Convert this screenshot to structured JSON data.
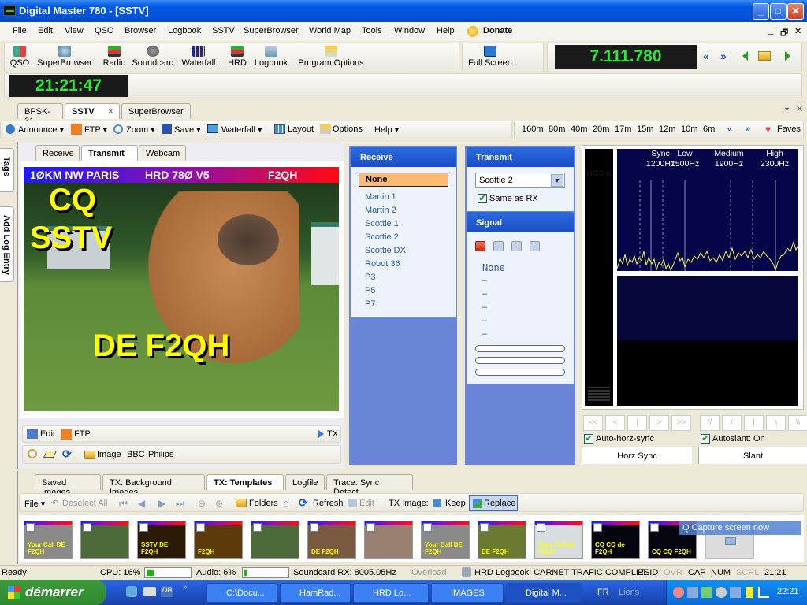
{
  "window": {
    "title": "Digital Master 780 - [SSTV]",
    "minimize": "_",
    "maximize": "□",
    "close": "✕"
  },
  "menu": {
    "items": [
      "File",
      "Edit",
      "View",
      "QSO",
      "Browser",
      "Logbook",
      "SSTV",
      "SuperBrowser",
      "World Map",
      "Tools",
      "Window",
      "Help"
    ],
    "donate": "Donate",
    "mdi_controls": [
      "_",
      "🗗",
      "✕"
    ]
  },
  "toolbar": {
    "buttons": [
      {
        "label": "QSO",
        "icon": "qso-icon"
      },
      {
        "label": "SuperBrowser",
        "icon": "superbrowser-icon"
      },
      {
        "label": "Radio",
        "icon": "radio-icon"
      },
      {
        "label": "Soundcard",
        "icon": "soundcard-icon"
      },
      {
        "label": "Waterfall",
        "icon": "waterfall-icon"
      },
      {
        "label": "HRD",
        "icon": "hrd-icon"
      },
      {
        "label": "Logbook",
        "icon": "logbook-icon"
      },
      {
        "label": "Program Options",
        "icon": "program-options-icon"
      }
    ],
    "full_screen": "Full Screen",
    "frequency": "7.111.780",
    "freq_prev": "«",
    "freq_next": "»",
    "clock": "21:21:47"
  },
  "doc_tabs": [
    {
      "label": "BPSK-31",
      "active": false
    },
    {
      "label": "SSTV",
      "active": true
    },
    {
      "label": "SuperBrowser",
      "active": false
    }
  ],
  "sstv_toolbar": {
    "items": [
      "Announce ▾",
      "FTP ▾",
      "Zoom ▾",
      "Save ▾",
      "Waterfall ▾",
      "Layout",
      "Options",
      "Help ▾"
    ],
    "bands": [
      "160m",
      "80m",
      "40m",
      "20m",
      "17m",
      "15m",
      "12m",
      "10m",
      "6m"
    ],
    "band_prev": "«",
    "band_next": "»",
    "faves": "Faves"
  },
  "side_tabs": [
    "Tags",
    "Add Log Entry"
  ],
  "image_tabs": [
    {
      "label": "Receive",
      "active": false
    },
    {
      "label": "Transmit",
      "active": true
    },
    {
      "label": "Webcam",
      "active": false
    }
  ],
  "tx_image": {
    "header_left": "1ØKM NW PARIS",
    "header_mid": "HRD 78Ø V5",
    "header_right": "F2QH",
    "text_cq": "CQ",
    "text_sstv": "SSTV",
    "text_de": "DE F2QH"
  },
  "image_toolbar1": {
    "edit": "Edit",
    "ftp": "FTP",
    "tx": "TX"
  },
  "image_toolbar2": {
    "image": "Image",
    "bbc": "BBC",
    "philips": "Philips"
  },
  "receive_panel": {
    "title": "Receive",
    "selected": "None",
    "modes": [
      "Martin 1",
      "Martin 2",
      "Scottie 1",
      "Scottie 2",
      "Scottie DX",
      "Robot 36",
      "P3",
      "P5",
      "P7"
    ]
  },
  "transmit_panel": {
    "title": "Transmit",
    "mode_value": "Scottie 2",
    "same_as_rx_label": "Same as RX",
    "same_as_rx_checked": true
  },
  "signal_panel": {
    "title": "Signal",
    "value": "None",
    "dashes": [
      "–",
      "–",
      "–",
      "–",
      "–"
    ]
  },
  "spectrum": {
    "labels": [
      {
        "name": "Sync",
        "freq": "1200Hz"
      },
      {
        "name": "Low",
        "freq": "1500Hz"
      },
      {
        "name": "Medium",
        "freq": "1900Hz"
      },
      {
        "name": "High",
        "freq": "2300Hz"
      }
    ]
  },
  "sync_controls": {
    "horz_buttons": [
      "<<",
      "<",
      "|",
      ">",
      ">>"
    ],
    "slant_buttons": [
      "//",
      "/",
      "|",
      "\\",
      "\\\\"
    ],
    "auto_horz_sync": "Auto-horz-sync",
    "auto_horz_checked": true,
    "autoslant": "Autoslant: On",
    "autoslant_checked": true,
    "horz_sync_btn": "Horz Sync",
    "slant_btn": "Slant"
  },
  "bottom_tabs": [
    {
      "label": "Saved Images",
      "active": false
    },
    {
      "label": "TX: Background Images",
      "active": false
    },
    {
      "label": "TX: Templates",
      "active": true
    },
    {
      "label": "Logfile",
      "active": false
    },
    {
      "label": "Trace: Sync Detect",
      "active": false
    }
  ],
  "templates_toolbar": {
    "file": "File ▾",
    "deselect_all": "Deselect All",
    "folders": "Folders",
    "refresh": "Refresh",
    "edit": "Edit",
    "tx_image_label": "TX Image:",
    "keep": "Keep",
    "replace": "Replace"
  },
  "thumbnails": [
    {
      "caption": "Your Call DE F2QH",
      "bg": "#8a8a8a"
    },
    {
      "caption": "",
      "bg": "#4d6a3a"
    },
    {
      "caption": "SSTV DE F2QH",
      "bg": "#2b1a05"
    },
    {
      "caption": "F2QH",
      "bg": "#5c3a0a"
    },
    {
      "caption": "",
      "bg": "#4d6a3a"
    },
    {
      "caption": "DE F2QH",
      "bg": "#7a5a40"
    },
    {
      "caption": "",
      "bg": "#9a8070"
    },
    {
      "caption": "Your Call DE F2QH",
      "bg": "#8a8a8a"
    },
    {
      "caption": "DE F2QH",
      "bg": "#6a7a30"
    },
    {
      "caption": "Your Call de F2QH",
      "bg": "#d8dde0"
    },
    {
      "caption": "CQ CQ de F2QH",
      "bg": "#050510"
    },
    {
      "caption": "CQ CQ F2QH",
      "bg": "#050510"
    }
  ],
  "capture_tooltip": "Capture screen now",
  "status": {
    "ready": "Ready",
    "cpu": "CPU: 16%",
    "cpu_pct": 16,
    "audio": "Audio: 6%",
    "audio_pct": 6,
    "soundcard": "Soundcard RX: 8005.05Hz",
    "overload": "Overload",
    "logbook": "HRD Logbook: CARNET TRAFIC COMPLET",
    "rsid": "RSID",
    "ovr": "OVR",
    "cap": "CAP",
    "num": "NUM",
    "scrl": "SCRL",
    "time": "21:21"
  },
  "taskbar": {
    "start": "démarrer",
    "tasks": [
      {
        "label": "C:\\Docu...",
        "active": false
      },
      {
        "label": "HamRad...",
        "active": false
      },
      {
        "label": "HRD Lo...",
        "active": false
      },
      {
        "label": "IMAGES",
        "active": false
      },
      {
        "label": "Digital M...",
        "active": true
      }
    ],
    "lang": "FR",
    "links": "Liens",
    "clock": "22:21"
  }
}
